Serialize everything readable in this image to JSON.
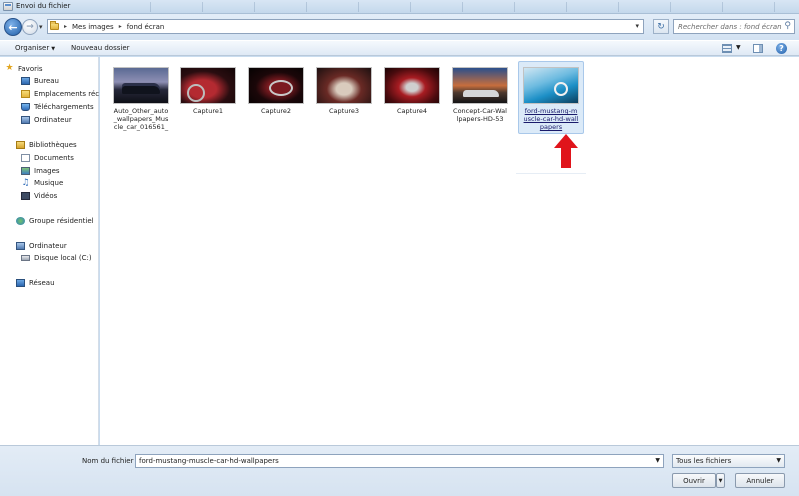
{
  "window": {
    "title": "Envoi du fichier"
  },
  "address": {
    "crumbs": [
      "Mes images",
      "fond écran"
    ],
    "search_placeholder": "Rechercher dans : fond écran"
  },
  "toolbar": {
    "organize_label": "Organiser",
    "new_folder_label": "Nouveau dossier"
  },
  "nav_pane": {
    "favorites": {
      "label": "Favoris",
      "items": [
        "Bureau",
        "Emplacements réce",
        "Téléchargements",
        "Ordinateur"
      ]
    },
    "libraries": {
      "label": "Bibliothèques",
      "items": [
        "Documents",
        "Images",
        "Musique",
        "Vidéos"
      ]
    },
    "homegroup": "Groupe résidentiel",
    "computer": {
      "label": "Ordinateur",
      "items": [
        "Disque local (C:)"
      ]
    },
    "network": "Réseau"
  },
  "files": [
    {
      "name": "Auto_Other_auto_wallpapers_Muscle_car_016561_",
      "display": "Auto_Other_auto\n_wallpapers_Mus\ncle_car_016561_"
    },
    {
      "name": "Capture1"
    },
    {
      "name": "Capture2"
    },
    {
      "name": "Capture3"
    },
    {
      "name": "Capture4"
    },
    {
      "name": "Concept-Car-Wallpapers-HD-53",
      "display": "Concept-Car-Wal\nlpapers-HD-53"
    },
    {
      "name": "ford-mustang-muscle-car-hd-wallpapers",
      "display": "ford-mustang-m\nuscle-car-hd-wall\npapers",
      "selected": true
    }
  ],
  "bottom": {
    "filename_label": "Nom du fichier :",
    "filename_value": "ford-mustang-muscle-car-hd-wallpapers",
    "filetype": "Tous les fichiers",
    "open_label": "Ouvrir",
    "cancel_label": "Annuler"
  },
  "colors": {
    "selection_bg": "#dbeaf8",
    "annotation_arrow": "#e0141b"
  }
}
